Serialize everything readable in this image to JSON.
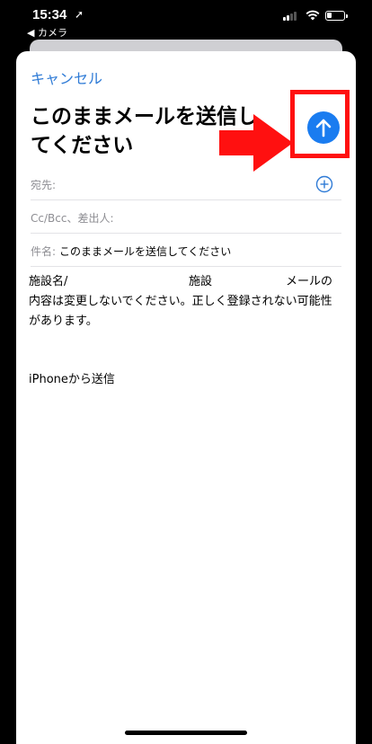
{
  "status_bar": {
    "time": "15:34",
    "back_app": "◀ カメラ"
  },
  "compose": {
    "cancel_label": "キャンセル",
    "title": "このままメールを送信してください",
    "send_button_color": "#1a7cf0",
    "highlight_color": "#ff1010"
  },
  "fields": {
    "to_label": "宛先:",
    "cc_label": "Cc/Bcc、差出人:",
    "subject_label": "件名:",
    "subject_value": "このままメールを送信してください"
  },
  "body": {
    "line1_a": "施設名/",
    "line1_b": "施設",
    "line1_c": "メールの",
    "line2": "内容は変更しないでください。正しく登録されない可能性があります。",
    "signature": "iPhoneから送信"
  },
  "icons": {
    "send": "arrow-up-icon",
    "add_recipient": "plus-circle-icon",
    "location": "location-arrow-icon",
    "signal": "cellular-signal-icon",
    "wifi": "wifi-icon",
    "battery": "battery-icon"
  }
}
